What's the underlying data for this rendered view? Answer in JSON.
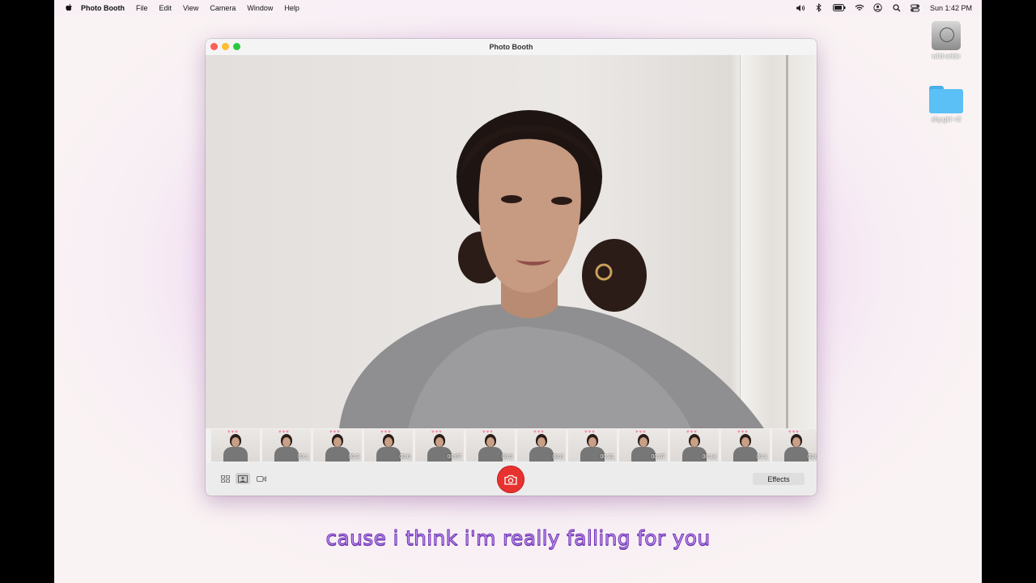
{
  "menubar": {
    "app_name": "Photo Booth",
    "menus": [
      "File",
      "Edit",
      "View",
      "Camera",
      "Window",
      "Help"
    ],
    "status_icons": [
      "volume-icon",
      "bluetooth-icon",
      "battery-icon",
      "wifi-icon",
      "user-icon",
      "search-icon",
      "control-center-icon"
    ],
    "clock": "Sun 1:42 PM"
  },
  "desktop": {
    "icons": [
      {
        "label": "wild-wilde",
        "icon": "disk-icon"
      },
      {
        "label": "shy.girl <3",
        "icon": "folder-icon"
      }
    ]
  },
  "window": {
    "title": "Photo Booth"
  },
  "strip": {
    "thumbnails": [
      {
        "duration": ""
      },
      {
        "duration": "00:1"
      },
      {
        "duration": "00:3"
      },
      {
        "duration": "00:0"
      },
      {
        "duration": "00:07"
      },
      {
        "duration": "00:0"
      },
      {
        "duration": "00:0"
      },
      {
        "duration": "00:21"
      },
      {
        "duration": "00:07"
      },
      {
        "duration": "00:14"
      },
      {
        "duration": "00:1"
      },
      {
        "duration": "00:0"
      }
    ]
  },
  "toolbar": {
    "effects_label": "Effects"
  },
  "caption": "cause i think i'm really falling for you"
}
